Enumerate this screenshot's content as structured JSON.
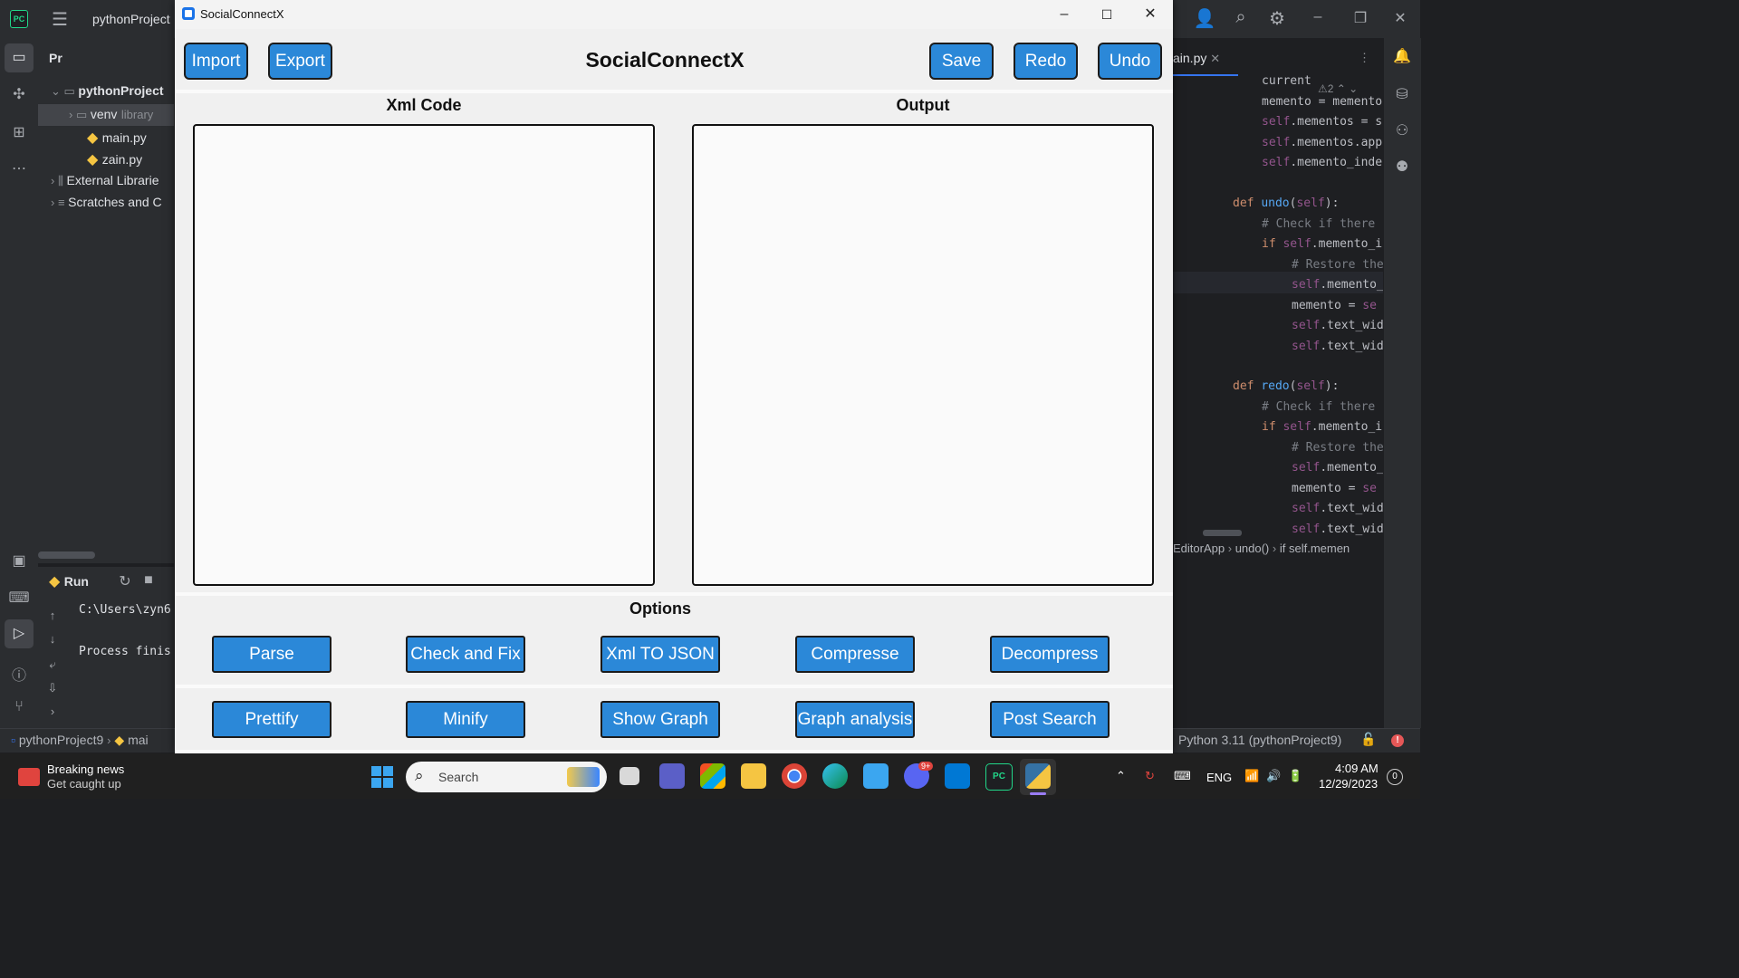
{
  "ide": {
    "project_title": "pythonProject",
    "project_panel_label": "Pr",
    "tree": {
      "root": "pythonProject",
      "venv": "venv",
      "venv_hint": "library",
      "file1": "main.py",
      "file2": "zain.py",
      "external": "External Librarie",
      "scratches": "Scratches and C"
    },
    "run_label": "Run",
    "console_line1": "C:\\Users\\zyn6",
    "console_line2": "Process finis",
    "editor_tab": "ain.py",
    "warning_count": "2",
    "breadcrumb": {
      "cls": "EditorApp",
      "method": "undo()",
      "stmt": "if self.memen"
    },
    "status_path1": "pythonProject9",
    "status_path2": "mai",
    "interpreter": "Python 3.11 (pythonProject9)"
  },
  "app": {
    "window_title": "SocialConnectX",
    "heading": "SocialConnectX",
    "buttons": {
      "import": "Import",
      "export": "Export",
      "save": "Save",
      "redo": "Redo",
      "undo": "Undo"
    },
    "xml_label": "Xml Code",
    "output_label": "Output",
    "xml_value": "",
    "output_value": "",
    "options_label": "Options",
    "options_row1": [
      "Parse",
      "Check and Fix",
      "Xml TO JSON",
      "Compresse",
      "Decompress"
    ],
    "options_row2": [
      "Prettify",
      "Minify",
      "Show Graph",
      "Graph analysis",
      "Post Search"
    ]
  },
  "taskbar": {
    "news_title": "Breaking news",
    "news_sub": "Get caught up",
    "search_placeholder": "Search",
    "discord_badge": "9+",
    "language": "ENG",
    "time": "4:09 AM",
    "date": "12/29/2023",
    "notification_count": "0"
  },
  "colors": {
    "accent": "#2b88d8",
    "ide_bg": "#2b2d30",
    "editor_bg": "#1e1f22",
    "taskbar_bg": "#202020"
  }
}
